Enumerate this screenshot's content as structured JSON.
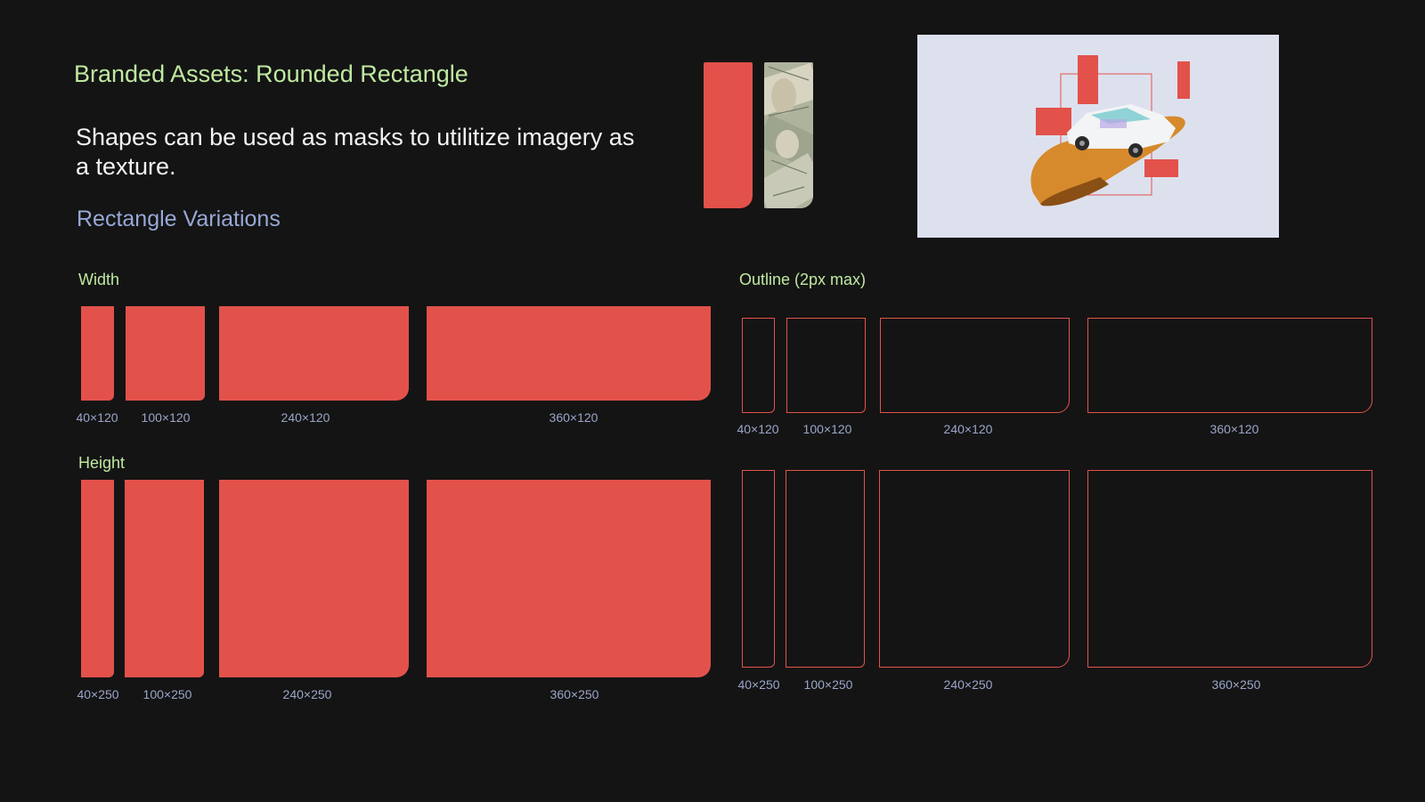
{
  "header": {
    "title": "Branded Assets: Rounded Rectangle",
    "lead": "Shapes can be used as masks to utilitize imagery as a texture.",
    "subhead": "Rectangle Variations"
  },
  "sections": {
    "width": "Width",
    "height": "Height",
    "outline": "Outline (2px max)"
  },
  "captions": {
    "width_row": [
      "40×120",
      "100×120",
      "240×120",
      "360×120"
    ],
    "height_row": [
      "40×250",
      "100×250",
      "240×250",
      "360×250"
    ],
    "outline_width_row": [
      "40×120",
      "100×120",
      "240×120",
      "360×120"
    ],
    "outline_height_row": [
      "40×250",
      "100×250",
      "240×250",
      "360×250"
    ]
  },
  "colors": {
    "background": "#141414",
    "brand_red": "#e2524b",
    "accent_green": "#bfe9a0",
    "accent_blue": "#98a8d6",
    "caption": "#9aa6c9"
  },
  "images": {
    "texture": "currency-texture-image",
    "example": "hand-holding-car-illustration"
  }
}
